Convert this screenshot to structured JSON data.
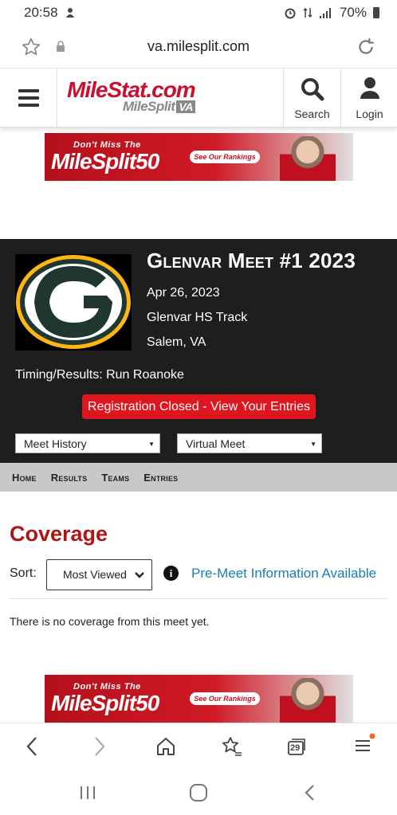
{
  "status_bar": {
    "time": "20:58",
    "battery": "70%"
  },
  "browser": {
    "url": "va.milesplit.com",
    "tab_count": "29"
  },
  "site": {
    "logo_main": "MileStat.com",
    "logo_sub": "MileSplit",
    "logo_region": "VA",
    "search_label": "Search",
    "login_label": "Login"
  },
  "ad": {
    "top_text": "Don't Miss The",
    "main_text": "MileSplit50",
    "button_text": "See Our Rankings"
  },
  "meet": {
    "title": "Glenvar Meet #1 2023",
    "date": "Apr 26, 2023",
    "venue": "Glenvar HS Track",
    "location": "Salem, VA",
    "timing": "Timing/Results: Run Roanoke",
    "registration_button": "Registration Closed - View Your Entries",
    "select_history": "Meet History",
    "select_virtual": "Virtual Meet",
    "logo_colors": {
      "green": "#203731",
      "gold": "#FFB612"
    }
  },
  "tabs": [
    "Home",
    "Results",
    "Teams",
    "Entries"
  ],
  "coverage": {
    "title": "Coverage",
    "sort_label": "Sort:",
    "sort_value": "Most Viewed",
    "info_link": "Pre-Meet Information Available",
    "empty_message": "There is no coverage from this meet yet."
  },
  "colors": {
    "brand_red": "#c8102e",
    "link_blue": "#1a7fb5",
    "dark_bg": "#1e1e1e",
    "button_red": "#e0161f"
  }
}
